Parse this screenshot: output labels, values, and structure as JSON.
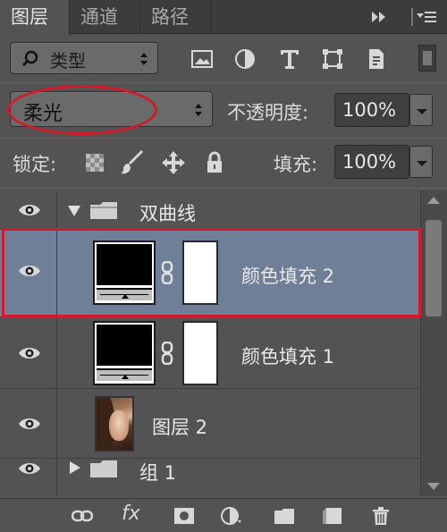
{
  "tabs": [
    {
      "label": "图层",
      "active": true
    },
    {
      "label": "通道",
      "active": false
    },
    {
      "label": "路径",
      "active": false
    }
  ],
  "filter": {
    "kind_label": "类型",
    "icons": [
      "image-filter-icon",
      "adjustment-filter-icon",
      "type-filter-icon",
      "shape-filter-icon",
      "smart-object-filter-icon"
    ]
  },
  "blend": {
    "mode": "柔光",
    "opacity_label": "不透明度:",
    "opacity_value": "100%"
  },
  "lock": {
    "label": "锁定:",
    "fill_label": "填充:",
    "fill_value": "100%"
  },
  "layers": [
    {
      "name": "双曲线",
      "type": "group-open"
    },
    {
      "name": "颜色填充 2",
      "type": "fill",
      "selected": true
    },
    {
      "name": "颜色填充 1",
      "type": "fill"
    },
    {
      "name": "图层 2",
      "type": "pixel"
    },
    {
      "name": "组 1",
      "type": "group-closed"
    }
  ],
  "colors": {
    "panel_bg": "#535353",
    "selected_row": "#6f7f98",
    "highlight_red": "#d6182a"
  },
  "toolbar": {
    "fx_label": "fx"
  }
}
